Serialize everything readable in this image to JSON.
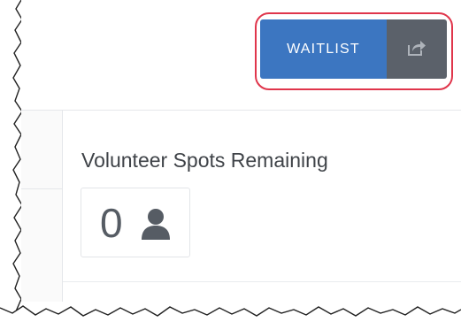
{
  "toolbar": {
    "waitlist_label": "WAITLIST",
    "share_icon": "share-icon"
  },
  "volunteer": {
    "title": "Volunteer Spots Remaining",
    "count": "0",
    "icon": "person-icon"
  },
  "colors": {
    "primary_button": "#3c76c1",
    "secondary_button": "#5b616a",
    "highlight_outline": "#e0354b",
    "text": "#3f4348"
  }
}
